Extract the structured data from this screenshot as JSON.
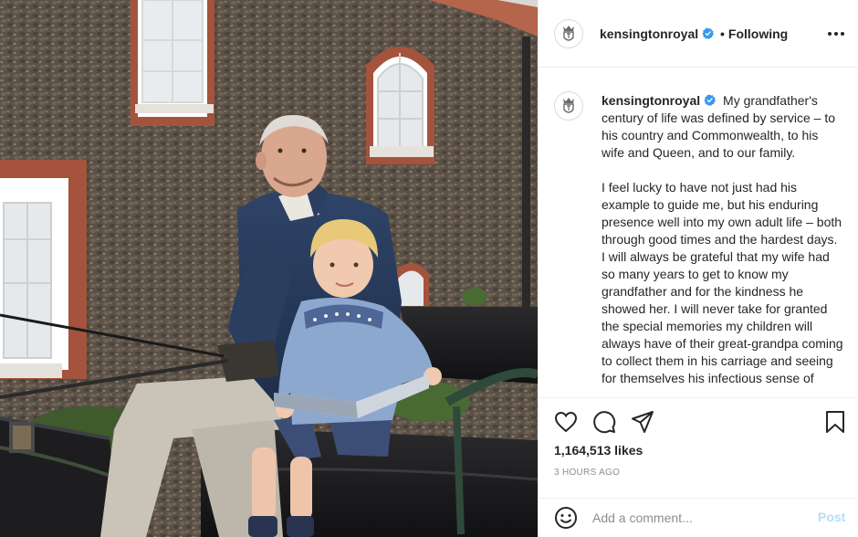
{
  "account": {
    "username": "kensingtonroyal",
    "verified": true,
    "follow_status": "Following",
    "follow_separator": "•"
  },
  "caption": {
    "paragraphs": [
      "My grandfather's century of life was defined by service – to his country and Commonwealth, to his wife and Queen, and to our family.",
      "I feel lucky to have not just had his example to guide me, but his enduring presence well into my own adult life – both through good times and the hardest days. I will always be grateful that my wife had so many years to get to know my grandfather and for the kindness he showed her. I will never take for granted the special memories my children will always have of their great-grandpa coming to collect them in his carriage and seeing for themselves his infectious sense of"
    ]
  },
  "stats": {
    "likes": "1,164,513 likes",
    "time": "3 HOURS AGO"
  },
  "comment": {
    "placeholder": "Add a comment...",
    "post_label": "Post"
  },
  "icons": {
    "like": "heart-icon",
    "comment": "comment-icon",
    "share": "share-icon",
    "save": "bookmark-icon",
    "more": "more-options-icon",
    "emoji": "emoji-icon",
    "verified": "verified-badge-icon"
  },
  "colors": {
    "verified_blue": "#3897f0",
    "post_disabled": "#b2dffc",
    "muted": "#8e8e8e"
  }
}
